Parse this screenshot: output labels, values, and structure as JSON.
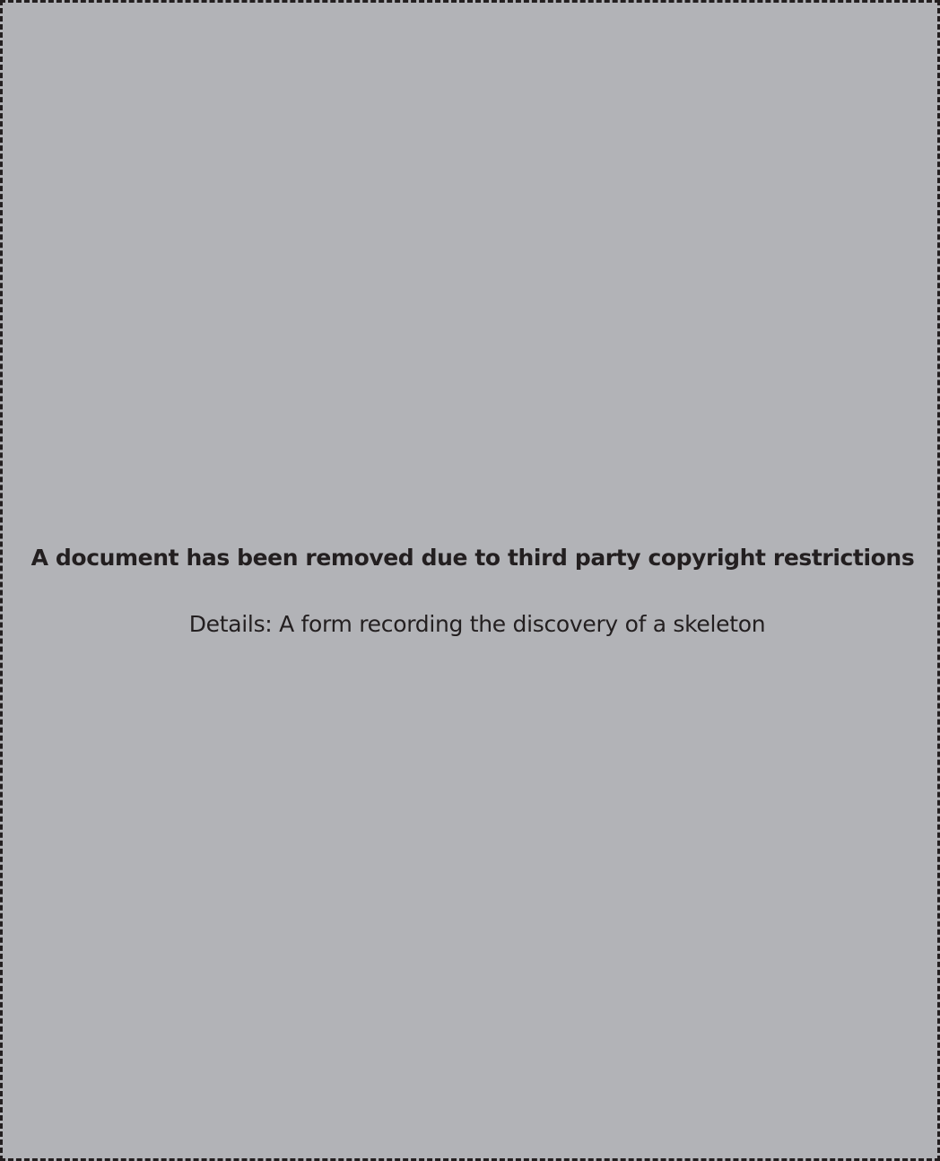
{
  "notice": {
    "title": "A document has been removed due to third party copyright restrictions",
    "details": "Details: A form recording the discovery of a skeleton"
  },
  "colors": {
    "background": "#b2b3b7",
    "border": "#231f20",
    "text": "#231f20"
  }
}
